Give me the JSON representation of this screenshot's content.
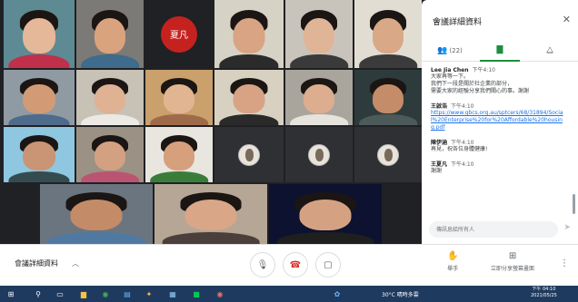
{
  "colors": {
    "accent": "#1e8e3e",
    "link": "#1a73e8",
    "hangup": "#d93025"
  },
  "tiles": [
    {
      "name": "",
      "bg": "#5d8a93",
      "skin": "#e6b89a",
      "shirt": "#c0304a"
    },
    {
      "name": "",
      "bg": "#7c7a76",
      "skin": "#d9a37e",
      "shirt": "#3f6b8c"
    },
    {
      "avatar_label": "夏凡",
      "avatar_color": "#c5221f",
      "bg": "#202124"
    },
    {
      "name": "",
      "bg": "#d7d2c6",
      "skin": "#d8a483",
      "shirt": "#2b2b2b"
    },
    {
      "name": "",
      "bg": "#c9c4bb",
      "skin": "#e0b597",
      "shirt": "#3a3a3a"
    },
    {
      "name": "",
      "bg": "#e2ddd3",
      "skin": "#d9a887",
      "shirt": "#3b3b3b"
    },
    {
      "name": "",
      "bg": "#8f9aa3",
      "skin": "#d29b76",
      "shirt": "#4f6b8b"
    },
    {
      "name": "",
      "bg": "#c7c1b6",
      "skin": "#deb293",
      "shirt": "#ece9e4"
    },
    {
      "name": "",
      "bg": "#caa06c",
      "skin": "#e2b592",
      "shirt": "#9f6a4a"
    },
    {
      "name": "",
      "bg": "#d8d1c2",
      "skin": "#d7a384",
      "shirt": "#2a2a2a"
    },
    {
      "name": "",
      "bg": "#a9a59d",
      "skin": "#dcae8f",
      "shirt": "#e6e3dd"
    },
    {
      "name": "",
      "bg": "#2d3b3d",
      "skin": "#c48c68",
      "shirt": "#4c5a5a"
    },
    {
      "name": "",
      "bg": "#8fc7e0",
      "skin": "#c99574",
      "shirt": "#344c4f"
    },
    {
      "name": "",
      "bg": "#9b9185",
      "skin": "#d3a082",
      "shirt": "#bb5472"
    },
    {
      "name": "",
      "bg": "#e9e6e0",
      "skin": "#d6a07d",
      "shirt": "#3a7d3a"
    },
    {
      "mini": true,
      "bg": "#2f3033"
    },
    {
      "mini": true,
      "bg": "#2f3033"
    },
    {
      "mini": true,
      "bg": "#2f3033"
    },
    {
      "name": "",
      "bg": "#6a7580",
      "skin": "#c48b68",
      "shirt": "#5079a2"
    },
    {
      "name": "",
      "bg": "#b5a696",
      "skin": "#d9a687",
      "shirt": "#4b3f3b"
    },
    {
      "name": "",
      "bg": "#0d1230",
      "skin": "#d4a283",
      "shirt": "#1f1f1f"
    }
  ],
  "panel": {
    "title": "會議詳細資料",
    "close_icon": "close-icon",
    "tabs": [
      {
        "label": "(22)",
        "icon": "people-icon"
      },
      {
        "label": "",
        "icon": "chat-icon"
      },
      {
        "label": "",
        "icon": "activities-icon"
      }
    ],
    "messages": [
      {
        "author": "Lee Jia Chen",
        "time": "下午4:10",
        "lines": [
          "大家再等一下。",
          "我們下一段是關於社企業的部分，",
          "需要大家的經驗分享我們關心的事。謝謝"
        ]
      },
      {
        "author": "王啟浩",
        "time": "下午4:10",
        "link": "https://www.gbcs.org.au/sptcers/68/31894/Social%20Enterprise%20for%20Affordable%20housing.pdf"
      },
      {
        "author": "陳伊涵",
        "time": "下午4:10",
        "lines": [
          "再見，祝各位身體健康!"
        ]
      },
      {
        "author": "王夏凡",
        "time": "下午4:10",
        "lines": [
          "謝謝"
        ]
      }
    ],
    "input_placeholder": "傳訊息給所有人"
  },
  "controls": {
    "meeting_details": "會議詳細資料",
    "raise_hand_label": "舉手",
    "present_label": "立即分享螢幕畫面"
  },
  "taskbar": {
    "weather": "30°C 晴時多雲",
    "time": "下午 04:10",
    "date": "2021/05/25"
  }
}
